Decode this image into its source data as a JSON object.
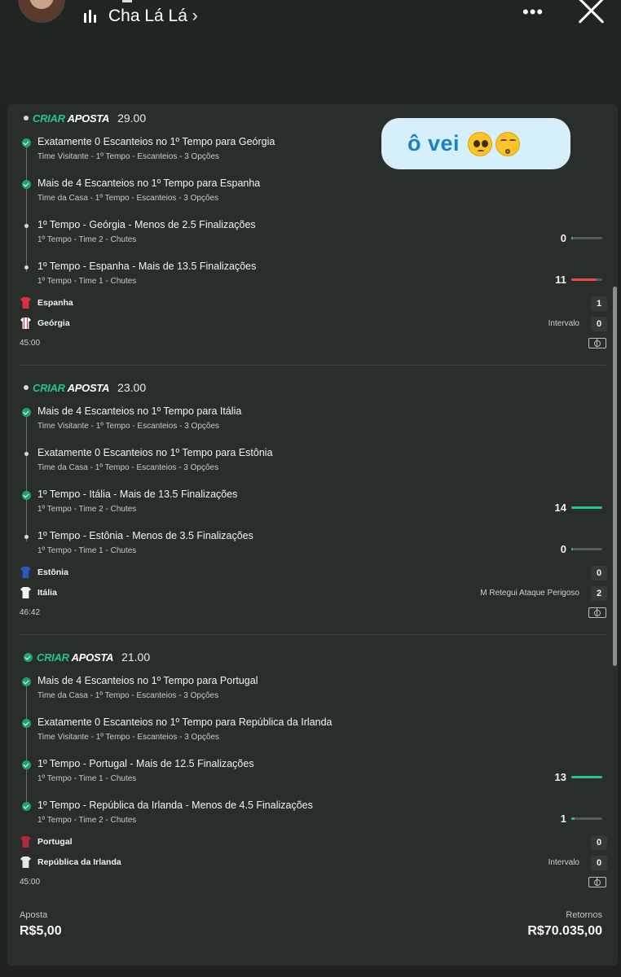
{
  "story": {
    "title": "Cha Lá Lá",
    "chevron": "›",
    "more": "•••"
  },
  "sticker": {
    "text": "ô vei"
  },
  "colors": {
    "accent": "#22c58a",
    "loss": "#e5484d",
    "bg": "#2a2e2b"
  },
  "bets": [
    {
      "brand_a": "CRIAR",
      "brand_b": "APOSTA",
      "odds": "29.00",
      "settled": false,
      "selections": [
        {
          "title": "Exatamente 0 Escanteios no 1º Tempo para Geórgia",
          "sub": "Time Visitante - 1º Tempo - Escanteios - 3 Opções",
          "status": "won",
          "stat": ""
        },
        {
          "title": "Mais de 4 Escanteios no 1º Tempo para Espanha",
          "sub": "Time da Casa - 1º Tempo - Escanteios - 3 Opções",
          "status": "won",
          "stat": ""
        },
        {
          "title": "1º Tempo - Geórgia - Menos de 2.5 Finalizações",
          "sub": "1º Tempo - Time 2 - Chutes",
          "status": "pending",
          "stat": "0",
          "progress": 0.05,
          "bar_color": "#22c58a"
        },
        {
          "title": "1º Tempo - Espanha - Mais de 13.5 Finalizações",
          "sub": "1º Tempo - Time 1 - Chutes",
          "status": "pending",
          "stat": "11",
          "progress": 0.82,
          "bar_color": "#e5484d"
        }
      ],
      "teams": [
        {
          "name": "Espanha",
          "info": "",
          "score": "1",
          "shirt": "red"
        },
        {
          "name": "Geórgia",
          "info": "Intervalo",
          "score": "0",
          "shirt": "white-red"
        }
      ],
      "clock": "45:00"
    },
    {
      "brand_a": "CRIAR",
      "brand_b": "APOSTA",
      "odds": "23.00",
      "settled": false,
      "selections": [
        {
          "title": "Mais de 4 Escanteios no 1º Tempo para Itália",
          "sub": "Time Visitante - 1º Tempo - Escanteios - 3 Opções",
          "status": "won",
          "stat": ""
        },
        {
          "title": "Exatamente 0 Escanteios no 1º Tempo para Estônia",
          "sub": "Time da Casa - 1º Tempo - Escanteios - 3 Opções",
          "status": "pending",
          "stat": ""
        },
        {
          "title": "1º Tempo - Itália - Mais de 13.5 Finalizações",
          "sub": "1º Tempo - Time 2 - Chutes",
          "status": "won",
          "stat": "14",
          "progress": 1.0,
          "bar_color": "#22c58a"
        },
        {
          "title": "1º Tempo - Estônia - Menos de 3.5 Finalizações",
          "sub": "1º Tempo - Time 1 - Chutes",
          "status": "pending",
          "stat": "0",
          "progress": 0.05,
          "bar_color": "#22c58a"
        }
      ],
      "teams": [
        {
          "name": "Estônia",
          "info": "",
          "score": "0",
          "shirt": "blue"
        },
        {
          "name": "Itália",
          "info": "M Retegui Ataque Perigoso",
          "score": "2",
          "shirt": "white"
        }
      ],
      "clock": "46:42"
    },
    {
      "brand_a": "CRIAR",
      "brand_b": "APOSTA",
      "odds": "21.00",
      "settled": true,
      "selections": [
        {
          "title": "Mais de 4 Escanteios no 1º Tempo para Portugal",
          "sub": "Time da Casa - 1º Tempo - Escanteios - 3 Opções",
          "status": "won",
          "stat": ""
        },
        {
          "title": "Exatamente 0 Escanteios no 1º Tempo para República da Irlanda",
          "sub": "Time Visitante - 1º Tempo - Escanteios - 3 Opções",
          "status": "won",
          "stat": ""
        },
        {
          "title": "1º Tempo - Portugal - Mais de 12.5 Finalizações",
          "sub": "1º Tempo - Time 1 - Chutes",
          "status": "won",
          "stat": "13",
          "progress": 1.0,
          "bar_color": "#22c58a"
        },
        {
          "title": "1º Tempo - República da Irlanda - Menos de 4.5 Finalizações",
          "sub": "1º Tempo - Time 2 - Chutes",
          "status": "won",
          "stat": "1",
          "progress": 0.1,
          "bar_color": "#22c58a"
        }
      ],
      "teams": [
        {
          "name": "Portugal",
          "info": "",
          "score": "0",
          "shirt": "maroon"
        },
        {
          "name": "República da Irlanda",
          "info": "Intervalo",
          "score": "0",
          "shirt": "white-gray"
        }
      ],
      "clock": "45:00"
    }
  ],
  "footer": {
    "stake_label": "Aposta",
    "stake_value": "R$5,00",
    "returns_label": "Retornos",
    "returns_value": "R$70.035,00"
  }
}
